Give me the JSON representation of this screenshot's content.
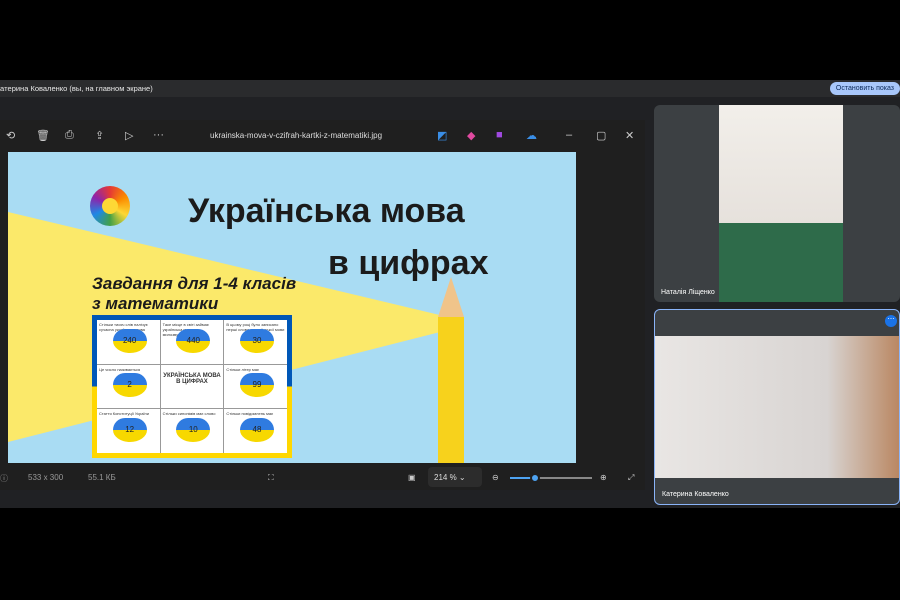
{
  "meeting": {
    "presenter_label": "aтерина Коваленко (вы, на главном экране)",
    "stop_button": "Остановить показ"
  },
  "viewer": {
    "filename": "ukrainska-mova-v-czifrah-kartki-z-matematiki.jpg",
    "dimensions": "533 x 300",
    "filesize": "55.1 КБ",
    "zoom": "214 %",
    "zoom_slider_fraction": 0.25
  },
  "image": {
    "title_line1": "Українська мова",
    "title_line2": "в цифрах",
    "subtitle_line1": "Завдання для 1-4 класів",
    "subtitle_line2": "з математики",
    "card_title": "УКРАЇНСЬКА МОВА В ЦИФРАХ",
    "cells": [
      {
        "text": "Стільки тисяч слів налічує сучасна українська мова",
        "number": "240"
      },
      {
        "text": "Таке місце в світі займає українська мова за милозвучністю",
        "number": "440"
      },
      {
        "text": "В цьому році було записано перші слова з української мови",
        "number": "30"
      },
      {
        "text": "Це число називається",
        "number": "2"
      },
      {
        "text": "",
        "number": ""
      },
      {
        "text": "Стільки літер має",
        "number": "99"
      },
      {
        "text": "Стаття Конституції України",
        "number": "12"
      },
      {
        "text": "Стільки синонімів має слово",
        "number": "10"
      },
      {
        "text": "Стільки повідомлень має",
        "number": "48"
      }
    ]
  },
  "participants": [
    {
      "name": "Наталія Ліщенко"
    },
    {
      "name": "Катерина Коваленко"
    }
  ]
}
